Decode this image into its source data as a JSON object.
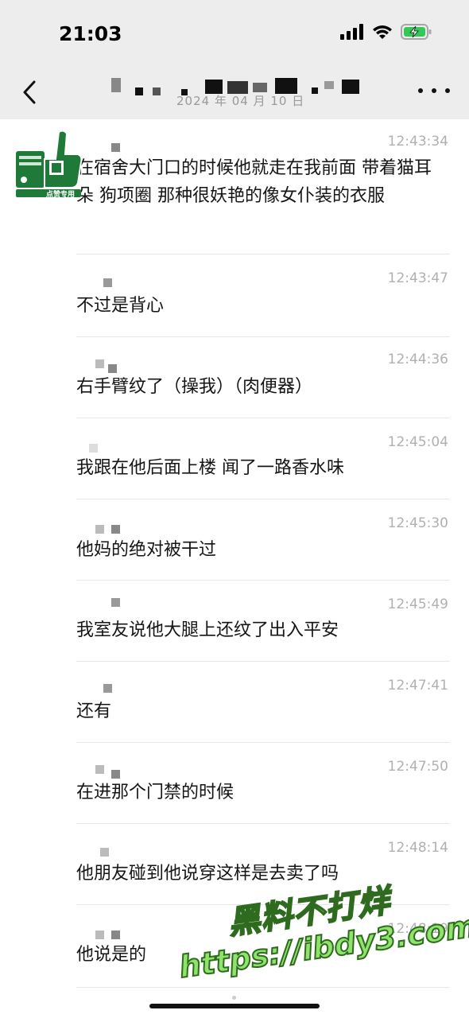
{
  "status_bar": {
    "time": "21:03",
    "icons": [
      "signal-icon",
      "wifi-icon",
      "battery-charging-icon"
    ],
    "battery_color": "#34c759"
  },
  "nav": {
    "back_icon": "chevron-left-icon",
    "title": "",
    "date": "2024 年 04 月 10 日",
    "more_icon": "more-icon"
  },
  "messages": [
    {
      "time": "12:43:34",
      "text": "在宿舍大门口的时候他就走在我前面 带着猫耳朵 狗项圈 那种很妖艳的像女仆装的衣服"
    },
    {
      "time": "12:43:47",
      "text": "不过是背心"
    },
    {
      "time": "12:44:36",
      "text": "右手臂纹了（操我）（肉便器）"
    },
    {
      "time": "12:45:04",
      "text": "我跟在他后面上楼 闻了一路香水味"
    },
    {
      "time": "12:45:30",
      "text": "他妈的绝对被干过"
    },
    {
      "time": "12:45:49",
      "text": "我室友说他大腿上还纹了出入平安"
    },
    {
      "time": "12:47:41",
      "text": "还有"
    },
    {
      "time": "12:47:50",
      "text": "在进那个门禁的时候"
    },
    {
      "time": "12:48:14",
      "text": "他朋友碰到他说穿这样是去卖了吗"
    },
    {
      "time": "12:48:19",
      "text": "他说是的"
    }
  ],
  "badge": {
    "icon": "thumbs-up-icon",
    "label": "点赞专用",
    "accent": "#1f7a3a"
  },
  "watermark": {
    "line1": "黑料不打烊",
    "line2": "https://ibdy3.com",
    "color": "#8fe36b"
  }
}
